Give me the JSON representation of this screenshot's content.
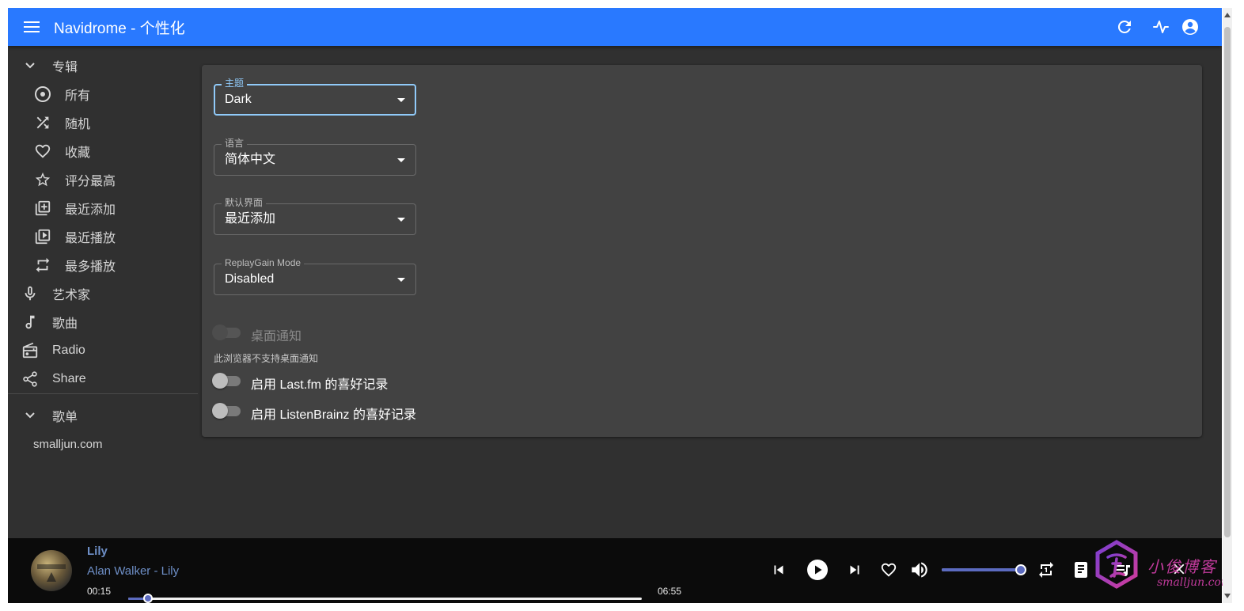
{
  "appbar": {
    "title": "Navidrome - 个性化",
    "icons": [
      "menu-icon",
      "refresh-icon",
      "activity-icon",
      "account-circle-icon"
    ],
    "color": "#2979ff"
  },
  "sidebar": {
    "albums_label": "专辑",
    "album_items": [
      {
        "label": "所有",
        "icon": "album-icon"
      },
      {
        "label": "随机",
        "icon": "shuffle-icon"
      },
      {
        "label": "收藏",
        "icon": "heart-icon"
      },
      {
        "label": "评分最高",
        "icon": "star-icon"
      },
      {
        "label": "最近添加",
        "icon": "library-add-icon"
      },
      {
        "label": "最近播放",
        "icon": "video-library-icon"
      },
      {
        "label": "最多播放",
        "icon": "repeat-icon"
      }
    ],
    "items": [
      {
        "label": "艺术家",
        "icon": "mic-icon"
      },
      {
        "label": "歌曲",
        "icon": "music-note-icon"
      },
      {
        "label": "Radio",
        "icon": "radio-icon"
      },
      {
        "label": "Share",
        "icon": "share-icon"
      }
    ],
    "playlists_label": "歌单",
    "playlist_items": [
      {
        "label": "smalljun.com"
      }
    ]
  },
  "settings": {
    "theme": {
      "label": "主题",
      "value": "Dark"
    },
    "language": {
      "label": "语言",
      "value": "简体中文"
    },
    "default_view": {
      "label": "默认界面",
      "value": "最近添加"
    },
    "replaygain": {
      "label": "ReplayGain Mode",
      "value": "Disabled"
    },
    "desktop_notifications": {
      "label": "桌面通知",
      "enabled": false,
      "disabled": true,
      "help": "此浏览器不支持桌面通知"
    },
    "lastfm": {
      "label": "启用 Last.fm 的喜好记录",
      "enabled": false
    },
    "listenbrainz": {
      "label": "启用 ListenBrainz 的喜好记录",
      "enabled": false
    }
  },
  "player": {
    "title": "Lily",
    "artist": "Alan Walker - Lily",
    "current_time": "00:15",
    "total_time": "06:55",
    "progress_fraction": 0.038,
    "volume_fraction": 1.0,
    "accent": "#5c6bc0"
  },
  "watermark": {
    "text": "小俊博客",
    "url": "smalljun.com"
  }
}
